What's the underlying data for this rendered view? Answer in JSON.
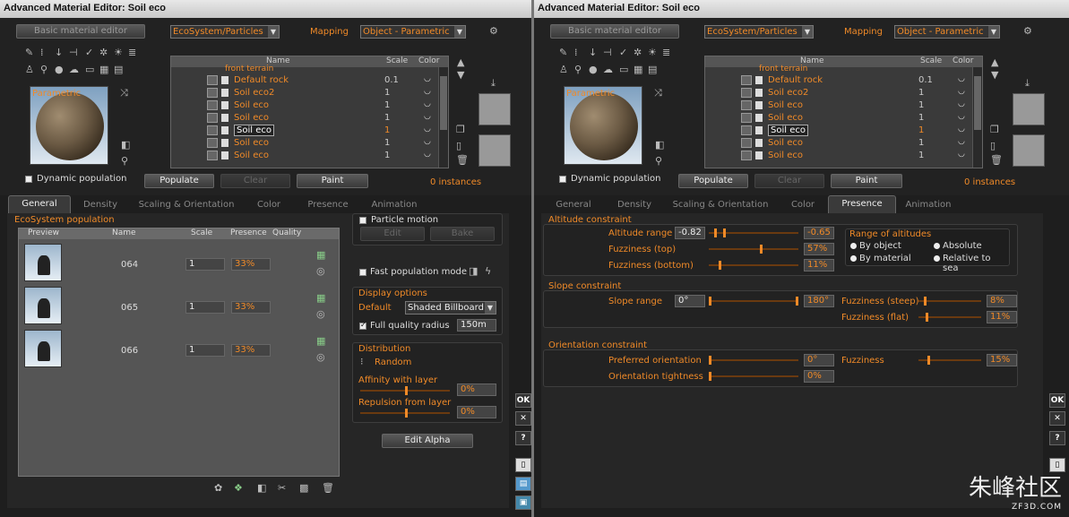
{
  "window_title": "Advanced Material Editor: Soil eco",
  "top": {
    "basic_button": "Basic material editor",
    "type_combo": "EcoSystem/Particles",
    "mapping_label": "Mapping",
    "mapping_combo": "Object - Parametric",
    "preview_label": "Parametric",
    "dynamic_population": "Dynamic population",
    "populate": "Populate",
    "clear": "Clear",
    "paint": "Paint",
    "instances": "0 instances",
    "list_headers": {
      "name": "Name",
      "scale": "Scale",
      "color": "Color"
    },
    "list_truncated_top": "front terrain",
    "left_items": [
      {
        "name": "Default rock",
        "scale": "0.1"
      },
      {
        "name": "Soil eco2",
        "scale": "1"
      },
      {
        "name": "Soil eco",
        "scale": "1"
      },
      {
        "name": "Soil eco",
        "scale": "1"
      },
      {
        "name": "Soil eco",
        "scale": "1"
      },
      {
        "name": "Soil eco",
        "scale": "1"
      },
      {
        "name": "Soil eco",
        "scale": "1"
      }
    ],
    "selected_index": 4
  },
  "tabs": [
    "General",
    "Density",
    "Scaling & Orientation",
    "Color",
    "Presence",
    "Animation"
  ],
  "left": {
    "active_tab": "General",
    "ecosystem_population": "EcoSystem population",
    "pop_headers": {
      "preview": "Preview",
      "name": "Name",
      "scale": "Scale",
      "presence": "Presence",
      "quality": "Quality"
    },
    "pop_rows": [
      {
        "name": "064",
        "scale": "1",
        "presence": "33%"
      },
      {
        "name": "065",
        "scale": "1",
        "presence": "33%"
      },
      {
        "name": "066",
        "scale": "1",
        "presence": "33%"
      }
    ],
    "particle_motion": "Particle motion",
    "edit": "Edit",
    "bake": "Bake",
    "fast_mode": "Fast population mode",
    "display_options": "Display options",
    "default_label": "Default",
    "display_combo": "Shaded Billboard",
    "full_quality": "Full quality radius",
    "radius_value": "150m",
    "distribution": "Distribution",
    "random": "Random",
    "affinity": "Affinity with layer",
    "affinity_value": "0%",
    "repulsion": "Repulsion from layer",
    "repulsion_value": "0%",
    "edit_alpha": "Edit Alpha"
  },
  "right": {
    "active_tab": "Presence",
    "altitude": {
      "title": "Altitude constraint",
      "range_label": "Altitude range",
      "range_min": "-0.82",
      "range_max": "-0.65",
      "fuzz_top_label": "Fuzziness (top)",
      "fuzz_top": "57%",
      "fuzz_bottom_label": "Fuzziness (bottom)",
      "fuzz_bottom": "11%",
      "range_of_altitudes": "Range of altitudes",
      "by_object": "By object",
      "absolute": "Absolute",
      "by_material": "By material",
      "relative_sea": "Relative to sea"
    },
    "slope": {
      "title": "Slope constraint",
      "range_label": "Slope range",
      "range_min": "0°",
      "range_max": "180°",
      "fuzz_steep_label": "Fuzziness (steep)",
      "fuzz_steep": "8%",
      "fuzz_flat_label": "Fuzziness (flat)",
      "fuzz_flat": "11%"
    },
    "orientation": {
      "title": "Orientation constraint",
      "preferred_label": "Preferred orientation",
      "preferred": "0°",
      "tightness_label": "Orientation tightness",
      "tightness": "0%",
      "fuzz_label": "Fuzziness",
      "fuzz": "15%"
    }
  },
  "side": {
    "ok": "OK",
    "cancel": "✕",
    "help": "?"
  },
  "watermark": {
    "main": "朱峰社区",
    "sub": "ZF3D.COM"
  }
}
